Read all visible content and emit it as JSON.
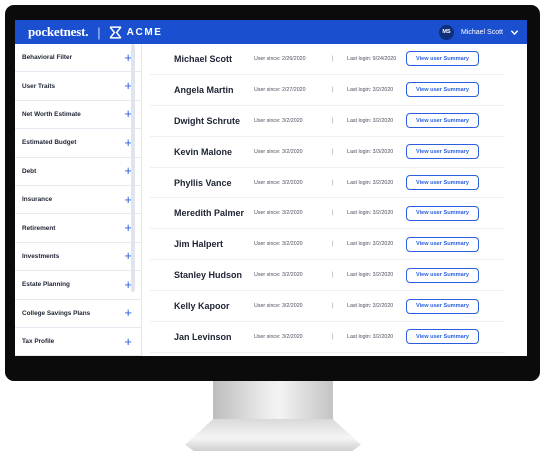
{
  "header": {
    "brand": "pocketnest.",
    "separator": "|",
    "partner": "ACME",
    "user_initials": "MS",
    "user_name": "Michael Scott"
  },
  "sidebar": {
    "items": [
      {
        "label": "Behavioral Filter"
      },
      {
        "label": "User Traits"
      },
      {
        "label": "Net Worth Estimate"
      },
      {
        "label": "Estimated Budget"
      },
      {
        "label": "Debt"
      },
      {
        "label": "Insurance"
      },
      {
        "label": "Retirement"
      },
      {
        "label": "Investments"
      },
      {
        "label": "Estate Planning"
      },
      {
        "label": "College Savings Plans"
      },
      {
        "label": "Tax Profile"
      }
    ],
    "add_glyph": "+"
  },
  "users": {
    "button_label": "View user Summary",
    "rows": [
      {
        "name": "Michael Scott",
        "since": "User since: 2/26/2020",
        "login": "Last login: 9/24/2020"
      },
      {
        "name": "Angela Martin",
        "since": "User since: 2/27/2020",
        "login": "Last login: 3/2/2020"
      },
      {
        "name": "Dwight Schrute",
        "since": "User since: 3/2/2020",
        "login": "Last login: 3/2/2020"
      },
      {
        "name": "Kevin Malone",
        "since": "User since: 3/2/2020",
        "login": "Last login: 3/3/2020"
      },
      {
        "name": "Phyllis Vance",
        "since": "User since: 3/2/2020",
        "login": "Last login: 3/2/2020"
      },
      {
        "name": "Meredith Palmer",
        "since": "User since: 3/2/2020",
        "login": "Last login: 3/2/2020"
      },
      {
        "name": "Jim Halpert",
        "since": "User since: 3/2/2020",
        "login": "Last login: 3/2/2020"
      },
      {
        "name": "Stanley Hudson",
        "since": "User since: 3/2/2020",
        "login": "Last login: 3/2/2020"
      },
      {
        "name": "Kelly Kapoor",
        "since": "User since: 3/2/2020",
        "login": "Last login: 3/2/2020"
      },
      {
        "name": "Jan Levinson",
        "since": "User since: 3/2/2020",
        "login": "Last login: 3/2/2020"
      }
    ]
  },
  "colors": {
    "accent": "#1a4fd0",
    "link": "#2a5fe0"
  },
  "icons": [
    "acme-logo-icon",
    "chevron-down-icon",
    "plus-icon"
  ]
}
